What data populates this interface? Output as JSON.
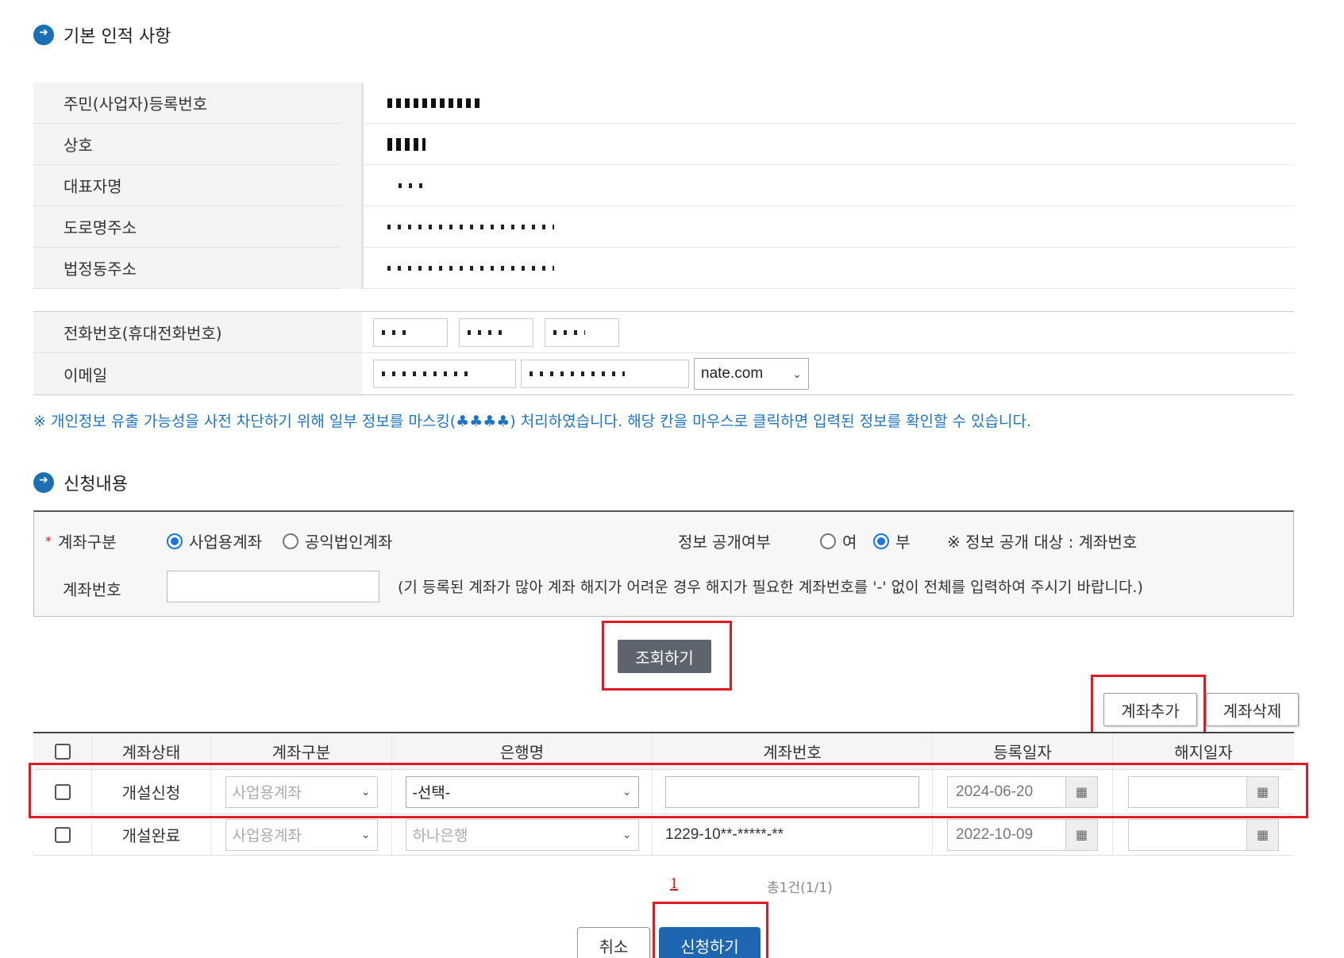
{
  "section1": {
    "title": "기본 인적 사항"
  },
  "info": {
    "rows": [
      {
        "label": "주민(사업자)등록번호"
      },
      {
        "label": "상호"
      },
      {
        "label": "대표자명"
      },
      {
        "label": "도로명주소"
      },
      {
        "label": "법정동주소"
      }
    ]
  },
  "contact": {
    "phone_label": "전화번호(휴대전화번호)",
    "email_label": "이메일",
    "email_domain": "nate.com"
  },
  "notice": "※ 개인정보 유출 가능성을 사전 차단하기 위해 일부 정보를 마스킹(♣♣♣♣) 처리하였습니다. 해당 칸을 마우스로 클릭하면 입력된 정보를 확인할 수 있습니다.",
  "section2": {
    "title": "신청내용"
  },
  "application": {
    "account_type_label": "계좌구분",
    "option_business": "사업용계좌",
    "option_public": "공익법인계좌",
    "disclosure_label": "정보 공개여부",
    "option_yes": "여",
    "option_no": "부",
    "disclosure_note": "※ 정보 공개 대상 : 계좌번호",
    "account_no_label": "계좌번호",
    "account_no_hint": "(기 등록된 계좌가 많아 계좌 해지가 어려운 경우 해지가 필요한 계좌번호를 '-' 없이 전체를 입력하여 주시기 바랍니다.)"
  },
  "buttons": {
    "search": "조회하기",
    "add_account": "계좌추가",
    "delete_account": "계좌삭제",
    "cancel": "취소",
    "apply": "신청하기"
  },
  "grid": {
    "headers": [
      "계좌상태",
      "계좌구분",
      "은행명",
      "계좌번호",
      "등록일자",
      "해지일자"
    ],
    "rows": [
      {
        "status": "개설신청",
        "type": "사업용계좌",
        "bank": "-선택-",
        "account": "",
        "reg_date": "2024-06-20",
        "end_date": ""
      },
      {
        "status": "개설완료",
        "type": "사업용계좌",
        "bank": "하나은행",
        "account": "1229-10**-*****-**",
        "reg_date": "2022-10-09",
        "end_date": ""
      }
    ]
  },
  "pagination": {
    "page": "1",
    "total": "총1건(1/1)"
  },
  "colors": {
    "accent_blue": "#1e66b0",
    "highlight_red": "#e01b24",
    "notice_blue": "#1c74c4"
  }
}
